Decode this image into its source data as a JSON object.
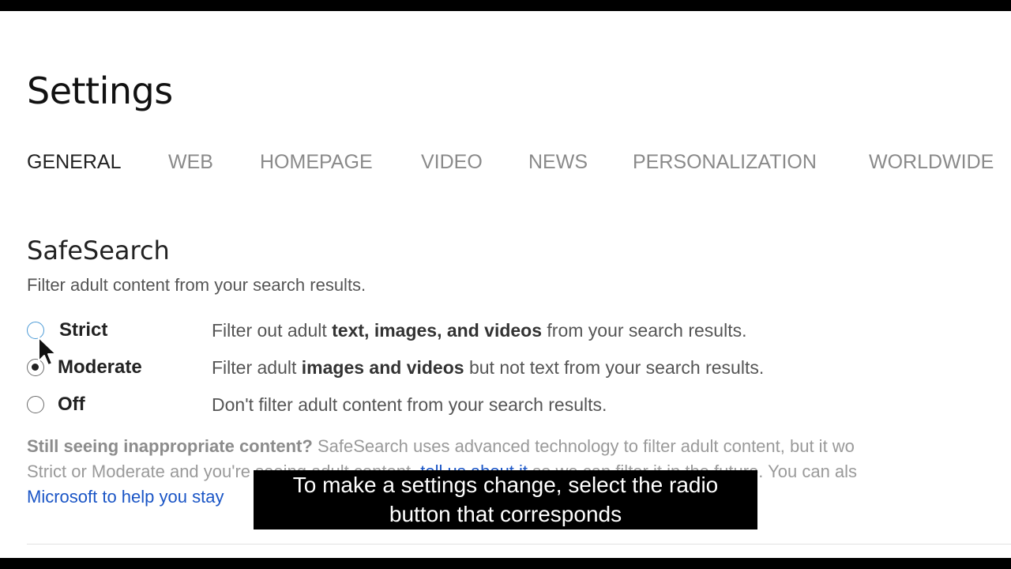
{
  "page": {
    "title": "Settings"
  },
  "tabs": [
    {
      "label": "GENERAL",
      "active": true
    },
    {
      "label": "WEB",
      "active": false
    },
    {
      "label": "HOMEPAGE",
      "active": false
    },
    {
      "label": "VIDEO",
      "active": false
    },
    {
      "label": "NEWS",
      "active": false
    },
    {
      "label": "PERSONALIZATION",
      "active": false
    },
    {
      "label": "WORLDWIDE",
      "active": false
    }
  ],
  "safesearch": {
    "heading": "SafeSearch",
    "description": "Filter adult content from your search results.",
    "selected": "Moderate",
    "options": [
      {
        "label": "Strict",
        "desc_pre": "Filter out adult ",
        "desc_bold": "text, images, and videos",
        "desc_post": " from your search results."
      },
      {
        "label": "Moderate",
        "desc_pre": "Filter adult ",
        "desc_bold": "images and videos",
        "desc_post": " but not text from your search results."
      },
      {
        "label": "Off",
        "desc_pre": "Don't filter adult content from your search results.",
        "desc_bold": "",
        "desc_post": ""
      }
    ],
    "note": {
      "bold": "Still seeing inappropriate content?",
      "line1_rest": " SafeSearch uses advanced technology to filter adult content, but it wo",
      "line2_pre": "Strict or Moderate and yo",
      "line2_hidden": "u're seeing adult content, ",
      "line2_link": "tell us about it",
      "line2_post": " so we can filter it in the future. You can als",
      "line3_link": "Microsoft to help you stay"
    }
  },
  "caption": {
    "line1": "To make a settings change, select the radio",
    "line2": "button that corresponds"
  },
  "icons": {
    "cursor": "mouse-pointer-icon"
  }
}
